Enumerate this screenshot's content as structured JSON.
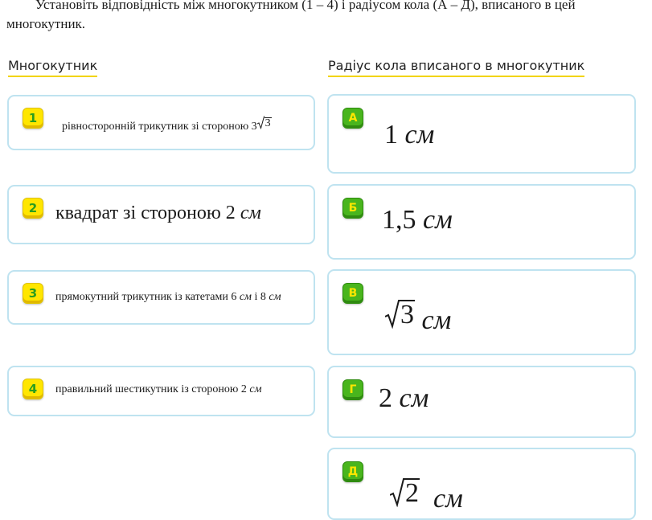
{
  "question": {
    "text": "Установіть відповідність між многокутником (1 – 4) і радіусом кола (А – Д), вписаного в цей многокутник."
  },
  "headers": {
    "left": "Многокутник",
    "right": "Радіус кола вписаного в многокутник"
  },
  "left_items": [
    {
      "badge": "1",
      "text": "рівносторонній трикутник зі стороною 3",
      "radical": "3",
      "unit": ""
    },
    {
      "badge": "2",
      "text": "квадрат зі стороною 2",
      "radical": "",
      "unit": "см"
    },
    {
      "badge": "3",
      "text": "прямокутний трикутник із катетами 6",
      "unit_a": "см",
      "mid": "і 8",
      "unit": "см"
    },
    {
      "badge": "4",
      "text": "правильний шестикутник із стороною 2",
      "radical": "",
      "unit": "см"
    }
  ],
  "right_items": [
    {
      "badge": "А",
      "value": "1",
      "radical": "",
      "unit": "см"
    },
    {
      "badge": "Б",
      "value": "1,5",
      "radical": "",
      "unit": "см"
    },
    {
      "badge": "В",
      "value": "",
      "radical": "3",
      "unit": "см"
    },
    {
      "badge": "Г",
      "value": "2",
      "radical": "",
      "unit": "см"
    },
    {
      "badge": "Д",
      "value": "",
      "radical": "2",
      "unit": "см"
    }
  ],
  "colors": {
    "card_border": "#bfe3f0",
    "header_underline": "#f2d400",
    "badge_left_bg": "#ffe600",
    "badge_right_bg": "#49b51d"
  }
}
